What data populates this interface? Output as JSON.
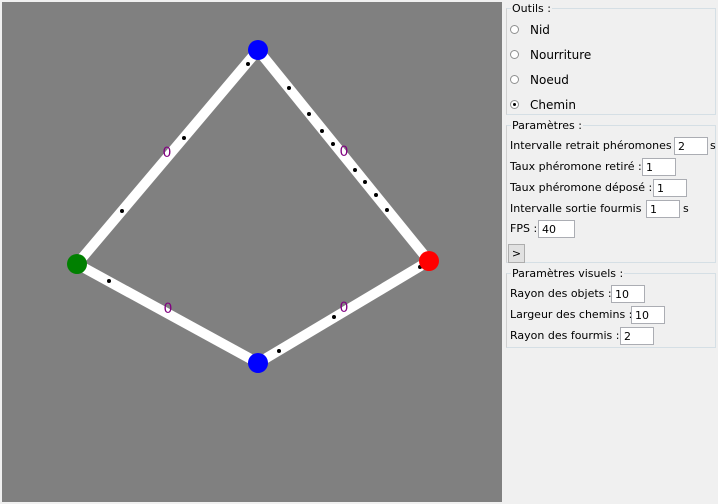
{
  "canvas": {
    "background": "#808080",
    "path_color": "#ffffff",
    "ant_color": "#000000",
    "pheromone_label_color": "#800080",
    "nodes": [
      {
        "name": "node-top",
        "type": "Noeud",
        "color": "#0000ff"
      },
      {
        "name": "node-nest",
        "type": "Nid",
        "color": "#008000"
      },
      {
        "name": "node-food",
        "type": "Nourriture",
        "color": "#ff0000"
      },
      {
        "name": "node-bottom",
        "type": "Noeud",
        "color": "#0000ff"
      }
    ],
    "paths": [
      {
        "name": "path-top-nest",
        "pheromone": "0"
      },
      {
        "name": "path-top-food",
        "pheromone": "0"
      },
      {
        "name": "path-nest-bottom",
        "pheromone": "0"
      },
      {
        "name": "path-bottom-food",
        "pheromone": "0"
      }
    ]
  },
  "tools": {
    "title": "Outils :",
    "options": [
      {
        "label": "Nid",
        "selected": false
      },
      {
        "label": "Nourriture",
        "selected": false
      },
      {
        "label": "Noeud",
        "selected": false
      },
      {
        "label": "Chemin",
        "selected": true
      }
    ]
  },
  "params": {
    "title": "Paramètres :",
    "withdraw_interval_label": "Intervalle retrait phéromones :",
    "withdraw_interval_value": "2",
    "withdraw_interval_unit": "s",
    "withdraw_rate_label": "Taux phéromone retiré :",
    "withdraw_rate_value": "1",
    "deposit_rate_label": "Taux phéromone déposé :",
    "deposit_rate_value": "1",
    "ant_interval_label": "Intervalle sortie fourmis :",
    "ant_interval_value": "1",
    "ant_interval_unit": "s",
    "fps_label": "FPS :",
    "fps_value": "40",
    "step_button": ">"
  },
  "visual": {
    "title": "Paramètres visuels :",
    "object_radius_label": "Rayon des objets :",
    "object_radius_value": "10",
    "path_width_label": "Largeur des chemins :",
    "path_width_value": "10",
    "ant_radius_label": "Rayon des fourmis :",
    "ant_radius_value": "2"
  }
}
